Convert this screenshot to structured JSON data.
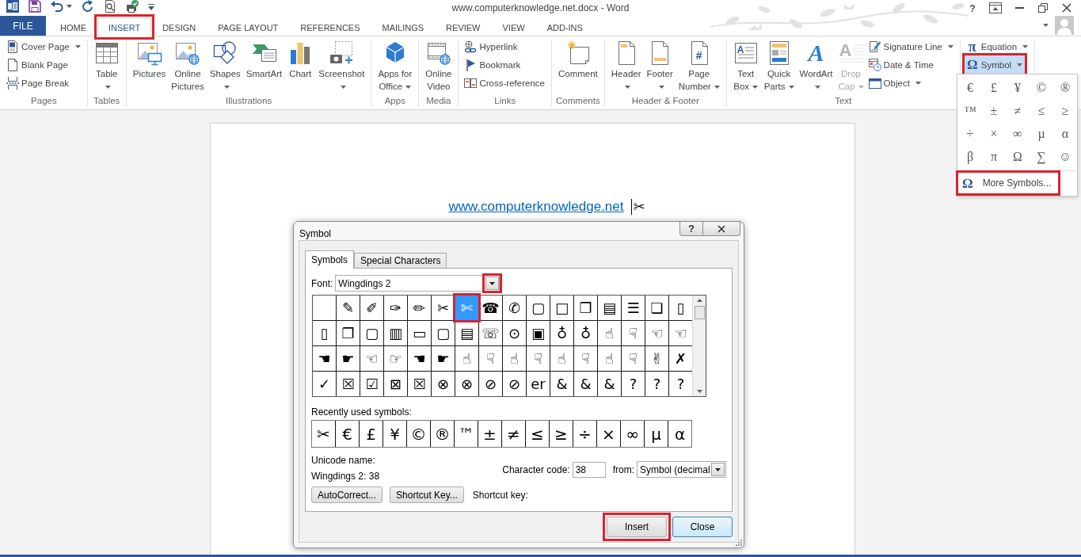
{
  "title_bar": {
    "title": "www.computerknowledge.net.docx - Word",
    "help_button": "?"
  },
  "tabs": [
    {
      "label": "FILE",
      "kind": "backstage",
      "selected": false,
      "highlighted": false
    },
    {
      "label": "HOME",
      "kind": "tab",
      "selected": false,
      "highlighted": false
    },
    {
      "label": "INSERT",
      "kind": "tab",
      "selected": true,
      "highlighted": true
    },
    {
      "label": "DESIGN",
      "kind": "tab",
      "selected": false,
      "highlighted": false
    },
    {
      "label": "PAGE LAYOUT",
      "kind": "tab",
      "selected": false,
      "highlighted": false
    },
    {
      "label": "REFERENCES",
      "kind": "tab",
      "selected": false,
      "highlighted": false
    },
    {
      "label": "MAILINGS",
      "kind": "tab",
      "selected": false,
      "highlighted": false
    },
    {
      "label": "REVIEW",
      "kind": "tab",
      "selected": false,
      "highlighted": false
    },
    {
      "label": "VIEW",
      "kind": "tab",
      "selected": false,
      "highlighted": false
    },
    {
      "label": "ADD-INS",
      "kind": "tab",
      "selected": false,
      "highlighted": false
    }
  ],
  "ribbon": {
    "groups": [
      {
        "label": "Pages",
        "items": [
          {
            "kind": "small",
            "lines": [
              "Cover Page"
            ],
            "caret": true
          },
          {
            "kind": "small",
            "lines": [
              "Blank Page"
            ],
            "caret": false
          },
          {
            "kind": "small",
            "lines": [
              "Page Break"
            ],
            "caret": false
          }
        ]
      },
      {
        "label": "Tables",
        "items": [
          {
            "kind": "large",
            "lines": [
              "Table"
            ],
            "caret": true
          }
        ]
      },
      {
        "label": "Illustrations",
        "items": [
          {
            "kind": "large",
            "lines": [
              "Pictures"
            ],
            "caret": false
          },
          {
            "kind": "large",
            "lines": [
              "Online",
              "Pictures"
            ],
            "caret": false
          },
          {
            "kind": "large",
            "lines": [
              "Shapes"
            ],
            "caret": true
          },
          {
            "kind": "large",
            "lines": [
              "SmartArt"
            ],
            "caret": false
          },
          {
            "kind": "large",
            "lines": [
              "Chart"
            ],
            "caret": false
          },
          {
            "kind": "large",
            "lines": [
              "Screenshot"
            ],
            "caret": true
          }
        ]
      },
      {
        "label": "Apps",
        "items": [
          {
            "kind": "large",
            "lines": [
              "Apps for",
              "Office"
            ],
            "caret": true
          }
        ]
      },
      {
        "label": "Media",
        "items": [
          {
            "kind": "large",
            "lines": [
              "Online",
              "Video"
            ],
            "caret": false
          }
        ]
      },
      {
        "label": "Links",
        "items": [
          {
            "kind": "small",
            "lines": [
              "Hyperlink"
            ],
            "caret": false
          },
          {
            "kind": "small",
            "lines": [
              "Bookmark"
            ],
            "caret": false
          },
          {
            "kind": "small",
            "lines": [
              "Cross-reference"
            ],
            "caret": false
          }
        ]
      },
      {
        "label": "Comments",
        "items": [
          {
            "kind": "large",
            "lines": [
              "Comment"
            ],
            "caret": false
          }
        ]
      },
      {
        "label": "Header & Footer",
        "items": [
          {
            "kind": "large",
            "lines": [
              "Header"
            ],
            "caret": true
          },
          {
            "kind": "large",
            "lines": [
              "Footer"
            ],
            "caret": true
          },
          {
            "kind": "large",
            "lines": [
              "Page",
              "Number"
            ],
            "caret": true,
            "glyph": "#"
          }
        ]
      },
      {
        "label": "Text",
        "items": [
          {
            "kind": "large",
            "lines": [
              "Text",
              "Box"
            ],
            "caret": true,
            "glyph": "A",
            "disabled": false
          },
          {
            "kind": "large",
            "lines": [
              "Quick",
              "Parts"
            ],
            "caret": true,
            "disabled": false
          },
          {
            "kind": "large",
            "lines": [
              "WordArt"
            ],
            "caret": true,
            "glyph": "A",
            "disabled": false
          },
          {
            "kind": "large",
            "lines": [
              "Drop",
              "Cap"
            ],
            "caret": true,
            "glyph": "A",
            "disabled": true
          },
          {
            "kind": "small",
            "lines": [
              "Signature Line"
            ],
            "caret": true,
            "disabled": false
          },
          {
            "kind": "small",
            "lines": [
              "Date & Time"
            ],
            "caret": false,
            "disabled": false
          },
          {
            "kind": "small",
            "lines": [
              "Object"
            ],
            "caret": true,
            "disabled": false
          }
        ]
      },
      {
        "items": [
          {
            "kind": "small",
            "lines": [
              "Equation"
            ],
            "caret": true,
            "glyph": "π",
            "selected": false,
            "highlighted": false
          },
          {
            "kind": "small",
            "lines": [
              "Symbol"
            ],
            "caret": true,
            "glyph": "Ω",
            "selected": true,
            "highlighted": true
          }
        ]
      }
    ]
  },
  "document": {
    "link": "www.computerknowledge.net",
    "inserted_symbol": "✂"
  },
  "symbol_menu": {
    "symbols": [
      "€",
      "£",
      "¥",
      "©",
      "®",
      "™",
      "±",
      "≠",
      "≤",
      "≥",
      "÷",
      "×",
      "∞",
      "µ",
      "α",
      "β",
      "π",
      "Ω",
      "∑",
      "☺"
    ],
    "more": {
      "glyph": "Ω",
      "label": "More Symbols...",
      "highlighted": true
    }
  },
  "symbol_dialog": {
    "title": "Symbol",
    "help_button": "?",
    "tabs": [
      {
        "label": "Symbols",
        "selected": true
      },
      {
        "label": "Special Characters",
        "selected": false
      }
    ],
    "font": {
      "label": "Font:",
      "value": "Wingdings 2",
      "highlighted": true
    },
    "grid": {
      "selection_highlighted": true,
      "rows": [
        [
          {
            "selected": false
          },
          {
            "glyph": "✎",
            "selected": false
          },
          {
            "glyph": "✐",
            "selected": false
          },
          {
            "glyph": "✑",
            "selected": false
          },
          {
            "glyph": "✏",
            "selected": false
          },
          {
            "glyph": "✂",
            "selected": false
          },
          {
            "glyph": "✄",
            "selected": true
          },
          {
            "glyph": "☎",
            "selected": false
          },
          {
            "glyph": "✆",
            "selected": false
          },
          {
            "glyph": "▢",
            "selected": false
          },
          {
            "glyph": "□",
            "selected": false
          },
          {
            "glyph": "❐",
            "selected": false
          },
          {
            "glyph": "▤",
            "selected": false
          },
          {
            "glyph": "☰",
            "selected": false
          },
          {
            "glyph": "❏",
            "selected": false
          },
          {
            "glyph": "▯",
            "selected": false
          }
        ],
        [
          {
            "glyph": "▯",
            "selected": false
          },
          {
            "glyph": "❐",
            "selected": false
          },
          {
            "glyph": "▢",
            "selected": false
          },
          {
            "glyph": "▥",
            "selected": false
          },
          {
            "glyph": "▭",
            "selected": false
          },
          {
            "glyph": "▢",
            "selected": false
          },
          {
            "glyph": "▤",
            "selected": false
          },
          {
            "glyph": "☏",
            "selected": false
          },
          {
            "glyph": "⊙",
            "selected": false
          },
          {
            "glyph": "▣",
            "selected": false
          },
          {
            "glyph": "♁",
            "selected": false
          },
          {
            "glyph": "♁",
            "selected": false
          },
          {
            "glyph": "☝",
            "selected": false
          },
          {
            "glyph": "☟",
            "selected": false
          },
          {
            "glyph": "☜",
            "selected": false
          },
          {
            "glyph": "☜",
            "selected": false
          }
        ],
        [
          {
            "glyph": "☚",
            "selected": false
          },
          {
            "glyph": "☛",
            "selected": false
          },
          {
            "glyph": "☜",
            "selected": false
          },
          {
            "glyph": "☞",
            "selected": false
          },
          {
            "glyph": "☚",
            "selected": false
          },
          {
            "glyph": "☛",
            "selected": false
          },
          {
            "glyph": "☝",
            "selected": false
          },
          {
            "glyph": "☟",
            "selected": false
          },
          {
            "glyph": "☝",
            "selected": false
          },
          {
            "glyph": "☟",
            "selected": false
          },
          {
            "glyph": "☝",
            "selected": false
          },
          {
            "glyph": "☟",
            "selected": false
          },
          {
            "glyph": "☝",
            "selected": false
          },
          {
            "glyph": "☟",
            "selected": false
          },
          {
            "glyph": "✌",
            "selected": false
          },
          {
            "glyph": "✗",
            "selected": false
          }
        ],
        [
          {
            "glyph": "✓",
            "selected": false
          },
          {
            "glyph": "☒",
            "selected": false
          },
          {
            "glyph": "☑",
            "selected": false
          },
          {
            "glyph": "⊠",
            "selected": false
          },
          {
            "glyph": "☒",
            "selected": false
          },
          {
            "glyph": "⊗",
            "selected": false
          },
          {
            "glyph": "⊗",
            "selected": false
          },
          {
            "glyph": "⊘",
            "selected": false
          },
          {
            "glyph": "⊘",
            "selected": false
          },
          {
            "glyph": "er",
            "selected": false
          },
          {
            "glyph": "&",
            "selected": false
          },
          {
            "glyph": "&",
            "selected": false
          },
          {
            "glyph": "&",
            "selected": false
          },
          {
            "glyph": "?",
            "selected": false
          },
          {
            "glyph": "?",
            "selected": false
          },
          {
            "glyph": "?",
            "selected": false
          }
        ]
      ]
    },
    "recent": {
      "label": "Recently used symbols:",
      "symbols": [
        "✂",
        "€",
        "£",
        "¥",
        "©",
        "®",
        "™",
        "±",
        "≠",
        "≤",
        "≥",
        "÷",
        "×",
        "∞",
        "µ",
        "α"
      ]
    },
    "unicode_name": {
      "label": "Unicode name:",
      "value": "Wingdings 2: 38"
    },
    "character_code": {
      "label": "Character code:",
      "value": "38"
    },
    "from": {
      "label": "from:",
      "value": "Symbol (decimal"
    },
    "buttons": [
      {
        "label": "AutoCorrect..."
      },
      {
        "label": "Shortcut Key..."
      }
    ],
    "shortcut_key": {
      "label": "Shortcut key:"
    },
    "footer_buttons": [
      {
        "label": "Insert",
        "default": false,
        "highlighted": true
      },
      {
        "label": "Close",
        "default": true,
        "highlighted": false
      }
    ]
  }
}
